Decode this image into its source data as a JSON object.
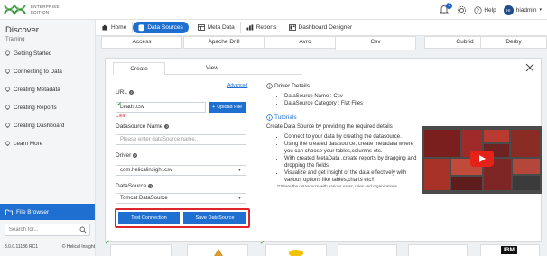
{
  "logo": {
    "line1": "ENTERPRISE",
    "line2": "EDITION"
  },
  "header": {
    "notification_count": "2",
    "help_label": "Help",
    "user_initials": "HI",
    "user_name": "hiadmin"
  },
  "sidebar": {
    "title": "Discover",
    "subtitle": "Training",
    "items": [
      {
        "label": "Getting Started"
      },
      {
        "label": "Connecting to Data"
      },
      {
        "label": "Creating Metadata"
      },
      {
        "label": "Creating Reports"
      },
      {
        "label": "Creating Dashboard"
      },
      {
        "label": "Learn More"
      }
    ],
    "file_browser_label": "File Browser",
    "search_placeholder": "Search for...",
    "version": "3.0.0.11186 RC1",
    "copyright": "© Helical Insight"
  },
  "nav": {
    "home": "Home",
    "data_sources": "Data Sources",
    "meta_data": "Meta Data",
    "reports": "Reports",
    "dashboard_designer": "Dashboard Designer"
  },
  "datasource_tiles": [
    "Access",
    "Apache Drill",
    "Avro",
    "Csv",
    "Cubrid",
    "Derby"
  ],
  "panel": {
    "tab_create": "Create",
    "tab_view": "View",
    "advanced_link": "Advanced",
    "url_label": "URL",
    "url_value": "Leads.csv",
    "upload_button": "Upload File",
    "clear_link": "Clear",
    "ds_name_label": "Datasource Name",
    "ds_name_placeholder": "Please enter dataSource name..",
    "driver_label": "Driver",
    "driver_value": "com.helicalinsight.csv",
    "datasource_label": "DataSource",
    "datasource_value": "Tomcat DataSource",
    "test_button": "Test Connection",
    "save_button": "Save DataSource"
  },
  "details": {
    "driver_details_heading": "Driver Details",
    "ds_name_line": "DataSource Name : Csv",
    "ds_category_line": "DataSource Category : Flat Files",
    "tutorials_heading": "Tutorials",
    "intro": "Create Data Source by providing the required details",
    "bullets": [
      "Connect to your data by creating the datasource.",
      "Using the created datasource, create metadata where you can choose your tables,columns etc.",
      "With created MetaData ,create reports by dragging and dropping the fields.",
      "Visualize and get insight of the data effectively with various options like tables,charts etc!!!"
    ],
    "note": "**Share the datasource with various users, roles and organizations."
  },
  "bottom_tiles": [
    "",
    "",
    "",
    "",
    "",
    "IBM"
  ],
  "colors": {
    "brand_blue": "#1f6fd1",
    "highlight_red": "#e0242c",
    "check_green": "#5bb24f"
  }
}
